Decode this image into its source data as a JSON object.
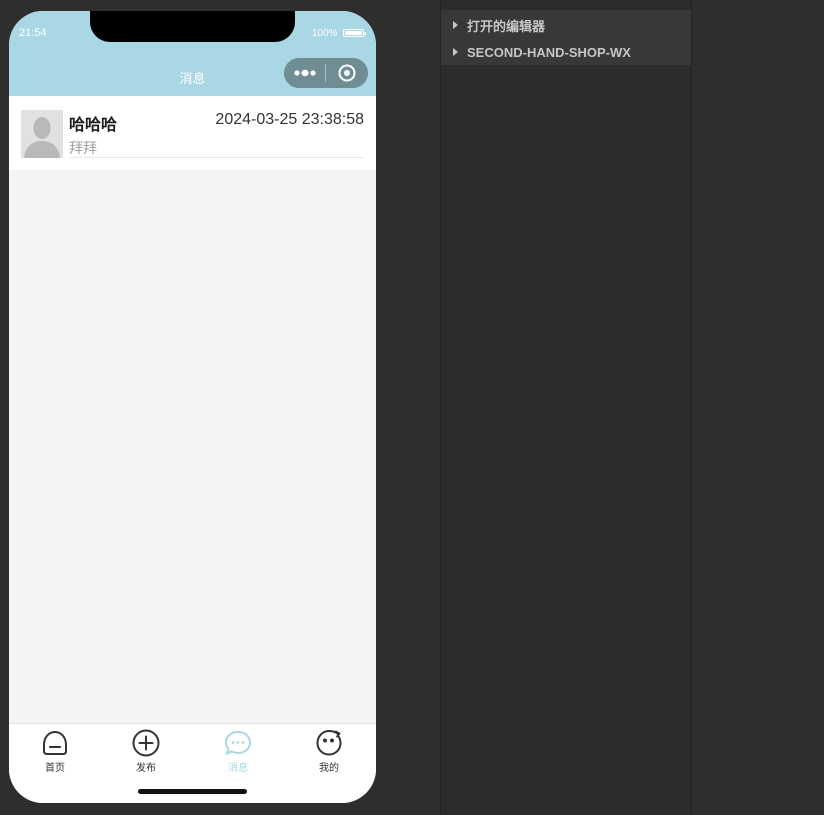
{
  "status_bar": {
    "time": "21:54",
    "battery": "100%"
  },
  "nav": {
    "title": "消息"
  },
  "messages": [
    {
      "name": "哈哈哈",
      "time": "2024-03-25 23:38:58",
      "preview": "拜拜"
    }
  ],
  "tabbar": {
    "items": [
      {
        "label": "首页",
        "icon": "home-icon"
      },
      {
        "label": "发布",
        "icon": "plus-circle-icon"
      },
      {
        "label": "消息",
        "icon": "chat-bubble-icon",
        "active": true
      },
      {
        "label": "我的",
        "icon": "smiley-icon"
      }
    ],
    "active_color": "#a9d8e4"
  },
  "explorer": {
    "sections": [
      {
        "label": "打开的编辑器"
      },
      {
        "label": "SECOND-HAND-SHOP-WX"
      }
    ]
  },
  "colors": {
    "header": "#a9d8e4",
    "ide_background": "#2e2e2e"
  }
}
